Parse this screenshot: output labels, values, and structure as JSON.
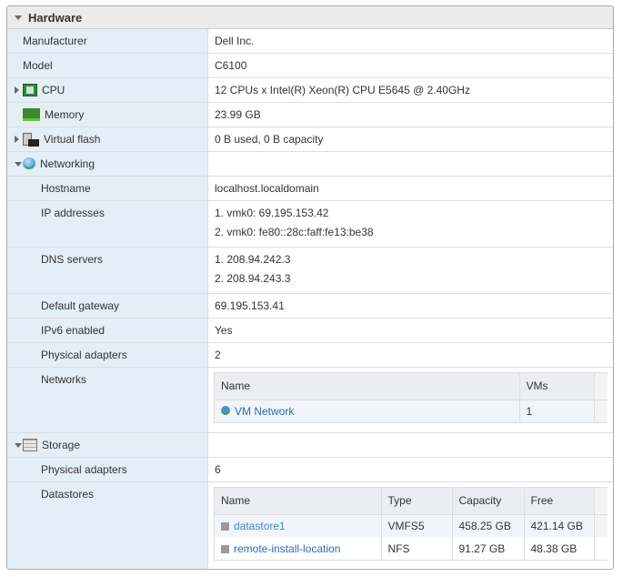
{
  "title": "Hardware",
  "rows": {
    "manufacturer": {
      "label": "Manufacturer",
      "value": "Dell Inc."
    },
    "model": {
      "label": "Model",
      "value": "C6100"
    },
    "cpu": {
      "label": "CPU",
      "value": "12 CPUs x Intel(R) Xeon(R) CPU E5645 @ 2.40GHz"
    },
    "memory": {
      "label": "Memory",
      "value": "23.99 GB"
    },
    "vflash": {
      "label": "Virtual flash",
      "value": "0 B used, 0 B capacity"
    },
    "networking": {
      "label": "Networking"
    },
    "hostname": {
      "label": "Hostname",
      "value": "localhost.localdomain"
    },
    "ip": {
      "label": "IP addresses",
      "values": [
        "1. vmk0: 69.195.153.42",
        "2. vmk0: fe80::28c:faff:fe13:be38"
      ]
    },
    "dns": {
      "label": "DNS servers",
      "values": [
        "1. 208.94.242.3",
        "2. 208.94.243.3"
      ]
    },
    "gateway": {
      "label": "Default gateway",
      "value": "69.195.153.41"
    },
    "ipv6": {
      "label": "IPv6 enabled",
      "value": "Yes"
    },
    "netadapters": {
      "label": "Physical adapters",
      "value": "2"
    },
    "networks": {
      "label": "Networks",
      "headers": [
        "Name",
        "VMs"
      ],
      "rows": [
        {
          "name": "VM Network",
          "vms": "1"
        }
      ]
    },
    "storage": {
      "label": "Storage"
    },
    "storadapters": {
      "label": "Physical adapters",
      "value": "6"
    },
    "datastores": {
      "label": "Datastores",
      "headers": [
        "Name",
        "Type",
        "Capacity",
        "Free"
      ],
      "rows": [
        {
          "name": "datastore1",
          "type": "VMFS5",
          "capacity": "458.25 GB",
          "free": "421.14 GB"
        },
        {
          "name": "remote-install-location",
          "type": "NFS",
          "capacity": "91.27 GB",
          "free": "48.38 GB"
        }
      ]
    }
  }
}
